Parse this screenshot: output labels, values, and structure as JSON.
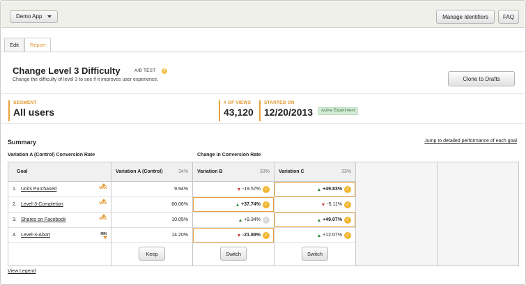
{
  "topbar": {
    "app_select": "Demo App",
    "manage_btn": "Manage Identifiers",
    "faq_btn": "FAQ"
  },
  "tabs": [
    "Edit",
    "Report"
  ],
  "experiment": {
    "title": "Change Level 3 Difficulty",
    "type": "A/B TEST",
    "help": "?",
    "description": "Change the difficulty of level 3 to see if it improves user experience.",
    "clone_btn": "Clone to Drafts"
  },
  "stats": {
    "segment_label": "SEGMENT",
    "segment_value": "All users",
    "views_label": "# OF VIEWS",
    "views_value": "43,120",
    "started_label": "STARTED ON",
    "started_value": "12/20/2013",
    "status_badge": "Active Experiment"
  },
  "summary": {
    "title": "Summary",
    "jump_link": "Jump to detailed performance of each goal",
    "section_a": "Variation A (Control) Conversion Rate",
    "section_b": "Change in Conversion Rate",
    "headers": {
      "goal": "Goal",
      "a": "Variation A (Control)",
      "a_pct": "34%",
      "b": "Variation B",
      "b_pct": "33%",
      "c": "Variation C",
      "c_pct": "33%"
    },
    "goals": [
      {
        "num": "1.",
        "name": "Units Purchased",
        "mark": "MAX",
        "a": "9.94%",
        "b": "-19.57%",
        "c": "+49.83%"
      },
      {
        "num": "2.",
        "name": "Level-3-Completion",
        "mark": "MAX",
        "a": "60.06%",
        "b": "+37.74%",
        "c": "-5.11%"
      },
      {
        "num": "3.",
        "name": "Shares on Facebook",
        "mark": "MAX",
        "a": "10.05%",
        "b": "+9.34%",
        "c": "+49.07%"
      },
      {
        "num": "4.",
        "name": "Level-3-Abort",
        "mark": "MIN",
        "a": "14.20%",
        "b": "-21.89%",
        "c": "+12.07%"
      }
    ],
    "buttons": {
      "a": "Keep",
      "b": "Switch",
      "c": "Switch"
    },
    "check": "✓",
    "legend_link": "View Legend"
  }
}
